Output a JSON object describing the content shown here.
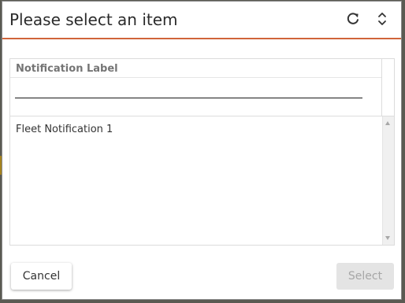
{
  "dialog": {
    "title": "Please select an item",
    "refresh_icon": "refresh-icon",
    "expand_icon": "expand-collapse-icon"
  },
  "grid": {
    "column_header": "Notification Label",
    "filter_value": "",
    "rows": [
      {
        "label": "Fleet Notification 1"
      }
    ]
  },
  "buttons": {
    "cancel": "Cancel",
    "select": "Select"
  },
  "colors": {
    "accent": "#d0643a",
    "disabled_button_bg": "#e4e4e4",
    "disabled_button_text": "#a6a6a6"
  }
}
